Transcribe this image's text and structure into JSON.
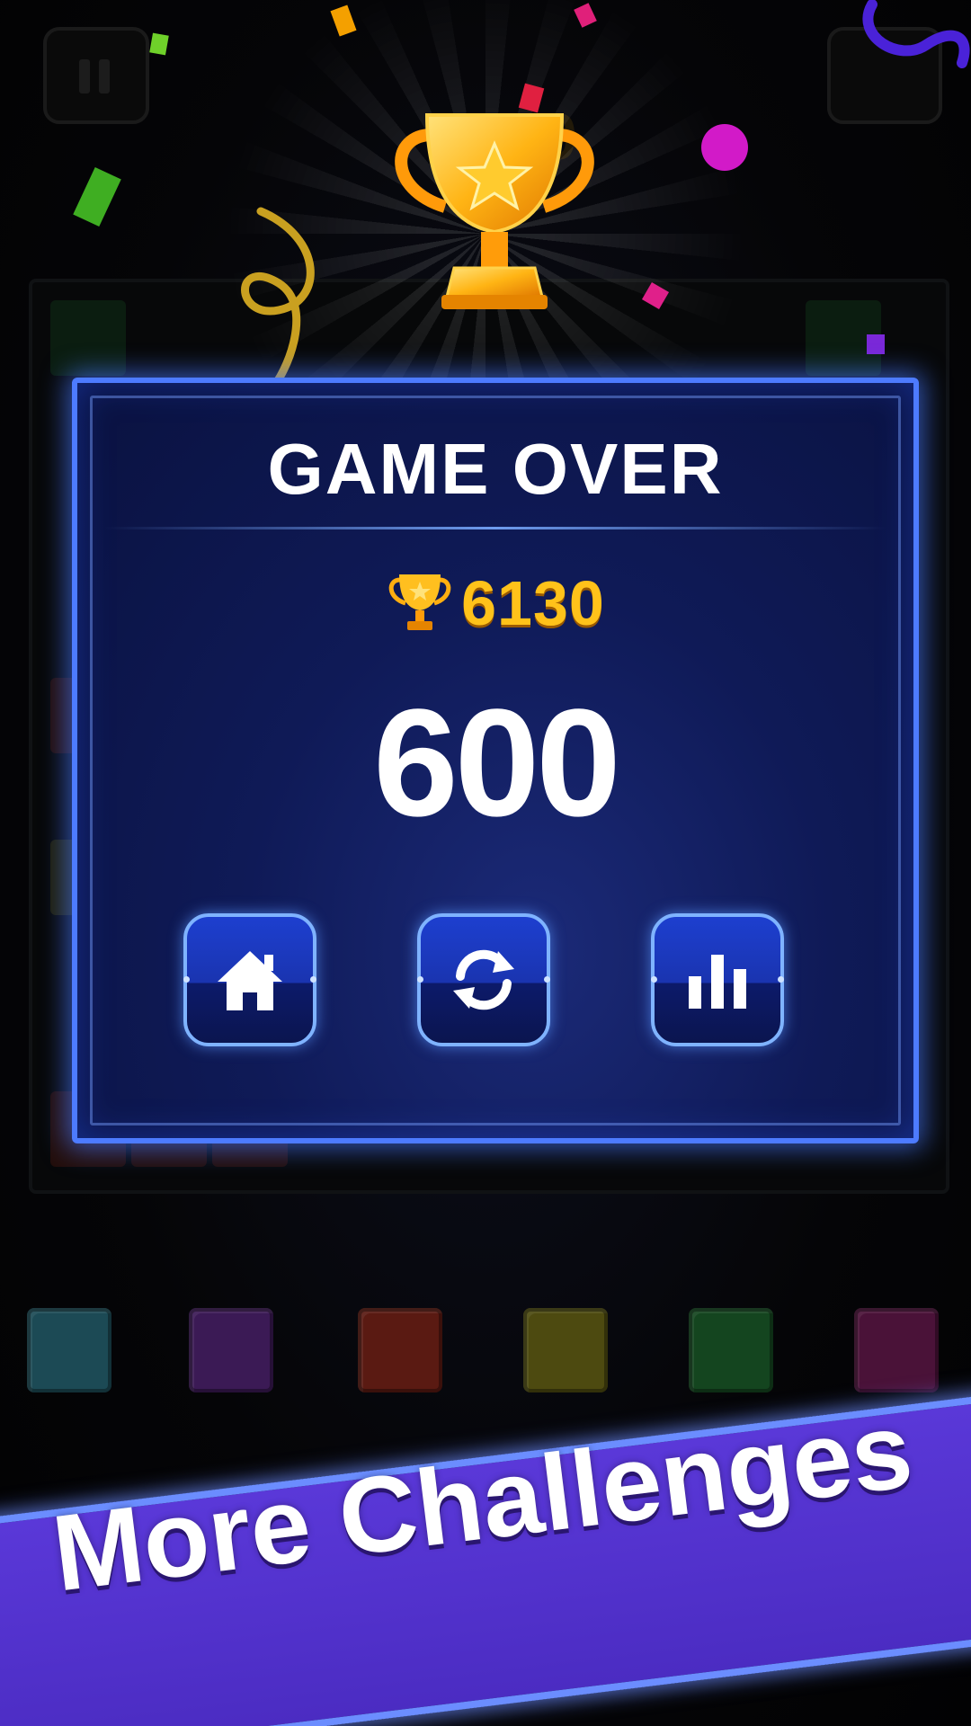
{
  "background": {
    "ghost_score_text": "6130",
    "board_colors": [
      "#1c4a55",
      "#3b1a55",
      "#5a1a12",
      "#4d4a10",
      "#14451f",
      "#4a1238"
    ]
  },
  "dialog": {
    "title": "GAME OVER",
    "best_score": "6130",
    "current_score": "600",
    "buttons": [
      {
        "icon": "home-icon"
      },
      {
        "icon": "restart-icon"
      },
      {
        "icon": "leaderboard-icon"
      }
    ]
  },
  "banner": {
    "text": "More Challenges"
  },
  "colors": {
    "panel_border": "#4d7bff",
    "panel_bg": "#0f1a57",
    "gold": "#ffc21a",
    "banner_bg": "#5a38d8"
  }
}
